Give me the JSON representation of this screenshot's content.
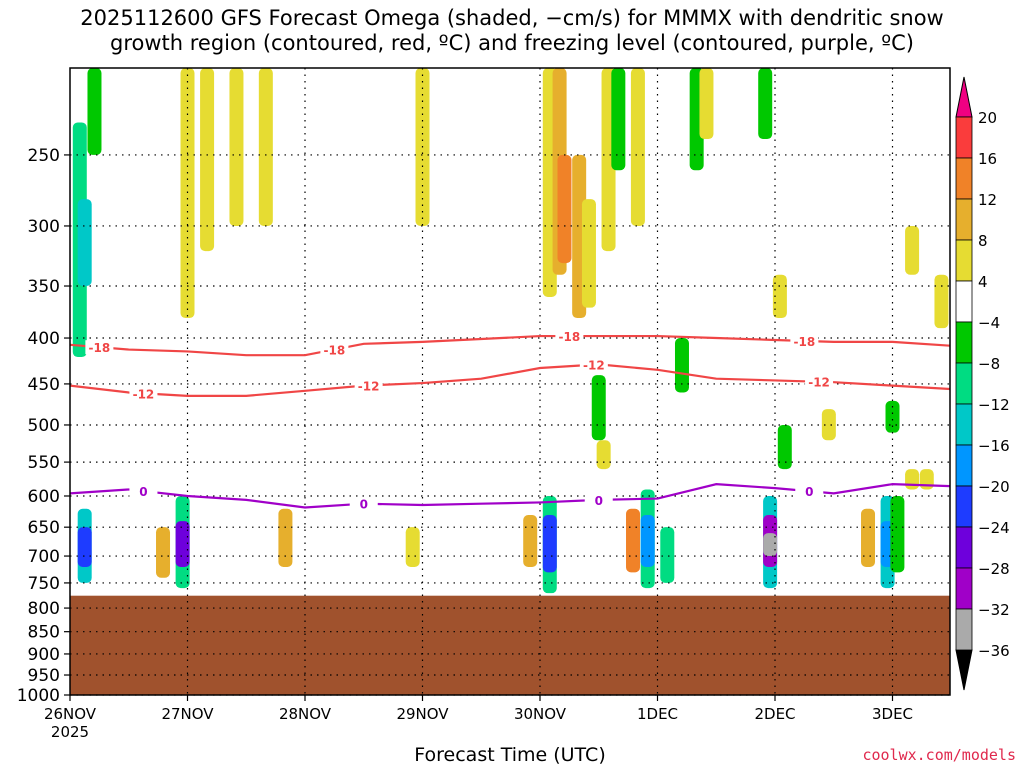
{
  "title_line1": "2025112600 GFS Forecast Omega (shaded, −cm/s) for MMMX with dendritic snow",
  "title_line2": "growth region (contoured, red, ºC) and freezing level (contoured, purple, ºC)",
  "x_axis_title": "Forecast Time (UTC)",
  "credit": "coolwx.com/models",
  "chart_data": {
    "type": "heatmap",
    "title": "2025112600 GFS Forecast Omega (shaded, −cm/s) for MMMX with dendritic snow growth region (contoured, red, ºC) and freezing level (contoured, purple, ºC)",
    "xlabel": "Forecast Time (UTC)",
    "ylabel": "",
    "x_ticks": [
      "26NOV",
      "27NOV",
      "28NOV",
      "29NOV",
      "30NOV",
      "1DEC",
      "2DEC",
      "3DEC"
    ],
    "x_year_label": "2025",
    "xlim_hours": [
      0,
      180
    ],
    "y_ticks": [
      250,
      300,
      350,
      400,
      450,
      500,
      550,
      600,
      650,
      700,
      750,
      800,
      850,
      900,
      950,
      1000
    ],
    "ylim_hPa": [
      1000,
      200
    ],
    "y_axis_reversed": true,
    "grid": true,
    "colorbar": {
      "levels": [
        -36,
        -32,
        -28,
        -24,
        -20,
        -16,
        -12,
        -8,
        -4,
        4,
        8,
        12,
        16,
        20
      ],
      "colors": [
        "#aaaaaa",
        "#a000c8",
        "#6e00dc",
        "#1e3cff",
        "#0096ff",
        "#00c8c8",
        "#00dc82",
        "#00c800",
        "#ffffff",
        "#e6dc32",
        "#e6af2d",
        "#f08228",
        "#fa3c3c"
      ],
      "below_color": "#000000",
      "above_color": "#f00082"
    },
    "terrain": {
      "color": "#a0522d",
      "top_hPa": 775
    },
    "contours": [
      {
        "color": "#f04646",
        "label": "-18",
        "points": [
          [
            0,
            407
          ],
          [
            12,
            412
          ],
          [
            24,
            414
          ],
          [
            36,
            418
          ],
          [
            48,
            418
          ],
          [
            60,
            406
          ],
          [
            72,
            404
          ],
          [
            84,
            401
          ],
          [
            96,
            398
          ],
          [
            108,
            398
          ],
          [
            120,
            398
          ],
          [
            132,
            400
          ],
          [
            144,
            402
          ],
          [
            156,
            404
          ],
          [
            168,
            404
          ],
          [
            180,
            408
          ]
        ]
      },
      {
        "color": "#f04646",
        "label": "-12",
        "points": [
          [
            0,
            452
          ],
          [
            12,
            460
          ],
          [
            24,
            464
          ],
          [
            36,
            464
          ],
          [
            48,
            458
          ],
          [
            60,
            452
          ],
          [
            72,
            449
          ],
          [
            84,
            444
          ],
          [
            96,
            432
          ],
          [
            108,
            428
          ],
          [
            120,
            434
          ],
          [
            132,
            444
          ],
          [
            144,
            446
          ],
          [
            156,
            448
          ],
          [
            168,
            452
          ],
          [
            180,
            456
          ]
        ]
      },
      {
        "color": "#a000c8",
        "label": "0",
        "points": [
          [
            0,
            596
          ],
          [
            12,
            590
          ],
          [
            24,
            600
          ],
          [
            36,
            606
          ],
          [
            48,
            618
          ],
          [
            60,
            612
          ],
          [
            72,
            614
          ],
          [
            84,
            612
          ],
          [
            96,
            610
          ],
          [
            108,
            606
          ],
          [
            120,
            604
          ],
          [
            132,
            582
          ],
          [
            144,
            588
          ],
          [
            156,
            596
          ],
          [
            168,
            582
          ],
          [
            180,
            585
          ]
        ]
      }
    ],
    "contour_label_times": {
      "-18": [
        6,
        54,
        102,
        150
      ],
      "-12": [
        15,
        61,
        107,
        153
      ],
      "0": [
        15,
        60,
        108,
        151
      ]
    },
    "shaded_cells": [
      {
        "t": 2,
        "p0": 230,
        "p1": 420,
        "v": -10
      },
      {
        "t": 3,
        "p0": 280,
        "p1": 350,
        "v": -14
      },
      {
        "t": 5,
        "p0": 200,
        "p1": 250,
        "v": -6
      },
      {
        "t": 24,
        "p0": 200,
        "p1": 380,
        "v": 6
      },
      {
        "t": 28,
        "p0": 200,
        "p1": 320,
        "v": 6
      },
      {
        "t": 34,
        "p0": 200,
        "p1": 300,
        "v": 6
      },
      {
        "t": 40,
        "p0": 200,
        "p1": 300,
        "v": 5
      },
      {
        "t": 72,
        "p0": 200,
        "p1": 300,
        "v": 5
      },
      {
        "t": 98,
        "p0": 200,
        "p1": 360,
        "v": 6
      },
      {
        "t": 100,
        "p0": 200,
        "p1": 340,
        "v": 9
      },
      {
        "t": 101,
        "p0": 250,
        "p1": 330,
        "v": 12
      },
      {
        "t": 104,
        "p0": 250,
        "p1": 380,
        "v": 8
      },
      {
        "t": 106,
        "p0": 280,
        "p1": 370,
        "v": 6
      },
      {
        "t": 110,
        "p0": 200,
        "p1": 320,
        "v": 6
      },
      {
        "t": 112,
        "p0": 200,
        "p1": 260,
        "v": -7
      },
      {
        "t": 116,
        "p0": 200,
        "p1": 300,
        "v": 5
      },
      {
        "t": 128,
        "p0": 200,
        "p1": 260,
        "v": -6
      },
      {
        "t": 130,
        "p0": 200,
        "p1": 240,
        "v": 5
      },
      {
        "t": 142,
        "p0": 200,
        "p1": 240,
        "v": -6
      },
      {
        "t": 145,
        "p0": 340,
        "p1": 380,
        "v": 5
      },
      {
        "t": 172,
        "p0": 300,
        "p1": 340,
        "v": 5
      },
      {
        "t": 178,
        "p0": 340,
        "p1": 390,
        "v": 5
      },
      {
        "t": 3,
        "p0": 620,
        "p1": 750,
        "v": -14
      },
      {
        "t": 3,
        "p0": 650,
        "p1": 720,
        "v": -22
      },
      {
        "t": 23,
        "p0": 600,
        "p1": 760,
        "v": -12
      },
      {
        "t": 23,
        "p0": 640,
        "p1": 720,
        "v": -26
      },
      {
        "t": 19,
        "p0": 650,
        "p1": 740,
        "v": 8
      },
      {
        "t": 44,
        "p0": 620,
        "p1": 720,
        "v": 8
      },
      {
        "t": 70,
        "p0": 650,
        "p1": 720,
        "v": 6
      },
      {
        "t": 94,
        "p0": 630,
        "p1": 720,
        "v": 9
      },
      {
        "t": 98,
        "p0": 600,
        "p1": 770,
        "v": -12
      },
      {
        "t": 98,
        "p0": 630,
        "p1": 730,
        "v": -22
      },
      {
        "t": 115,
        "p0": 620,
        "p1": 730,
        "v": 14
      },
      {
        "t": 118,
        "p0": 590,
        "p1": 760,
        "v": -12
      },
      {
        "t": 118,
        "p0": 630,
        "p1": 720,
        "v": -20
      },
      {
        "t": 122,
        "p0": 650,
        "p1": 750,
        "v": -10
      },
      {
        "t": 143,
        "p0": 600,
        "p1": 760,
        "v": -14
      },
      {
        "t": 143,
        "p0": 630,
        "p1": 720,
        "v": -30
      },
      {
        "t": 143,
        "p0": 660,
        "p1": 700,
        "v": -34
      },
      {
        "t": 163,
        "p0": 620,
        "p1": 720,
        "v": 8
      },
      {
        "t": 167,
        "p0": 600,
        "p1": 760,
        "v": -14
      },
      {
        "t": 167,
        "p0": 640,
        "p1": 720,
        "v": -18
      },
      {
        "t": 169,
        "p0": 600,
        "p1": 730,
        "v": -8
      },
      {
        "t": 172,
        "p0": 560,
        "p1": 590,
        "v": 6
      },
      {
        "t": 175,
        "p0": 560,
        "p1": 590,
        "v": 6
      },
      {
        "t": 108,
        "p0": 440,
        "p1": 520,
        "v": -7
      },
      {
        "t": 109,
        "p0": 520,
        "p1": 560,
        "v": 5
      },
      {
        "t": 125,
        "p0": 400,
        "p1": 460,
        "v": -8
      },
      {
        "t": 146,
        "p0": 500,
        "p1": 560,
        "v": -7
      },
      {
        "t": 155,
        "p0": 480,
        "p1": 520,
        "v": 5
      },
      {
        "t": 168,
        "p0": 470,
        "p1": 510,
        "v": -7
      }
    ]
  }
}
